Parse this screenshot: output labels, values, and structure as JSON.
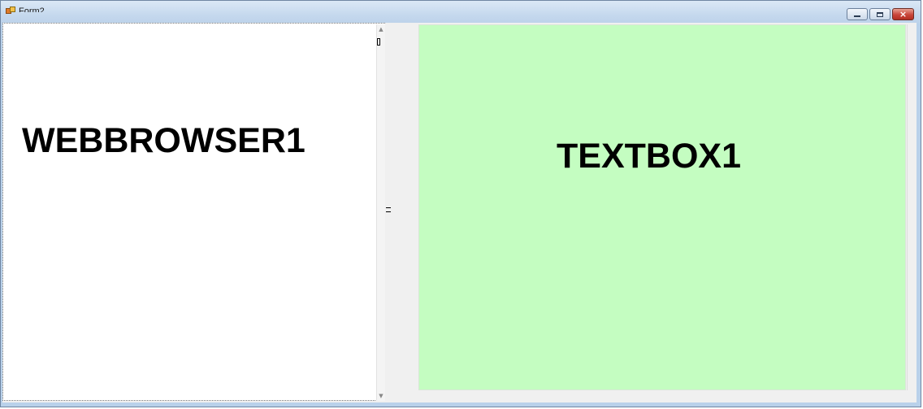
{
  "window": {
    "title": "Form2",
    "controls": {
      "minimize": "minimize",
      "maximize": "maximize",
      "close": "×"
    }
  },
  "webbrowser": {
    "label": "WEBBROWSER1"
  },
  "textbox": {
    "label": "TEXTBOX1"
  },
  "colors": {
    "textbox_background": "#c4fdc1",
    "webbrowser_background": "#ffffff"
  },
  "scrollbar": {
    "up": "▲",
    "down": "▼"
  }
}
